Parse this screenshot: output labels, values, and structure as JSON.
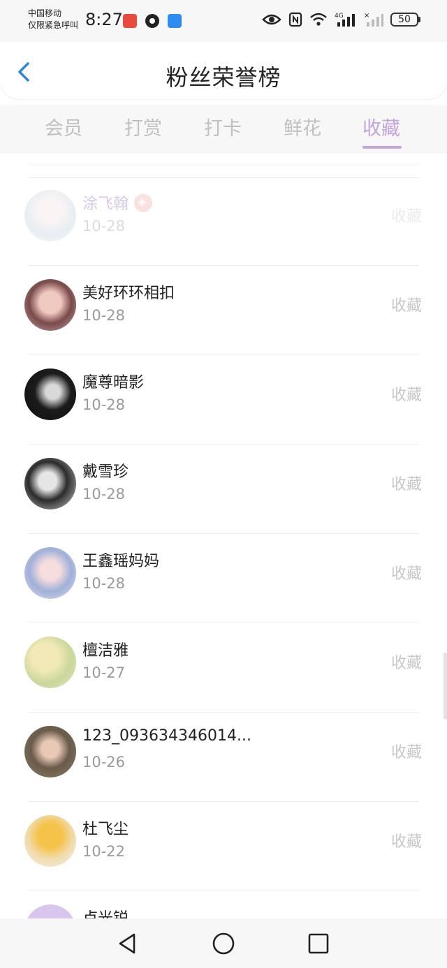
{
  "status_bar": {
    "carrier_line1": "中国移动",
    "carrier_line2": "仅限紧急呼叫",
    "time": "8:27",
    "battery": "50",
    "network": "4G"
  },
  "header": {
    "title": "粉丝荣誉榜"
  },
  "tabs": [
    {
      "label": "会员",
      "active": false
    },
    {
      "label": "打赏",
      "active": false
    },
    {
      "label": "打卡",
      "active": false
    },
    {
      "label": "鲜花",
      "active": false
    },
    {
      "label": "收藏",
      "active": true
    }
  ],
  "fans": [
    {
      "name": "涂飞翰",
      "date": "10-28",
      "action": "收藏",
      "vip": true
    },
    {
      "name": "美好环环相扣",
      "date": "10-28",
      "action": "收藏"
    },
    {
      "name": "魔尊暗影",
      "date": "10-28",
      "action": "收藏"
    },
    {
      "name": "戴雪珍",
      "date": "10-28",
      "action": "收藏"
    },
    {
      "name": "王鑫瑶妈妈",
      "date": "10-28",
      "action": "收藏"
    },
    {
      "name": "檀洁雅",
      "date": "10-27",
      "action": "收藏"
    },
    {
      "name": "123_093634346014...",
      "date": "10-26",
      "action": "收藏"
    },
    {
      "name": "杜飞尘",
      "date": "10-22",
      "action": "收藏"
    },
    {
      "name": "卢光锐",
      "date": "",
      "action": ""
    }
  ],
  "colors": {
    "accent": "#c3a3dc",
    "back_arrow": "#2f86e0",
    "inactive_tab": "#c0c0c0"
  }
}
